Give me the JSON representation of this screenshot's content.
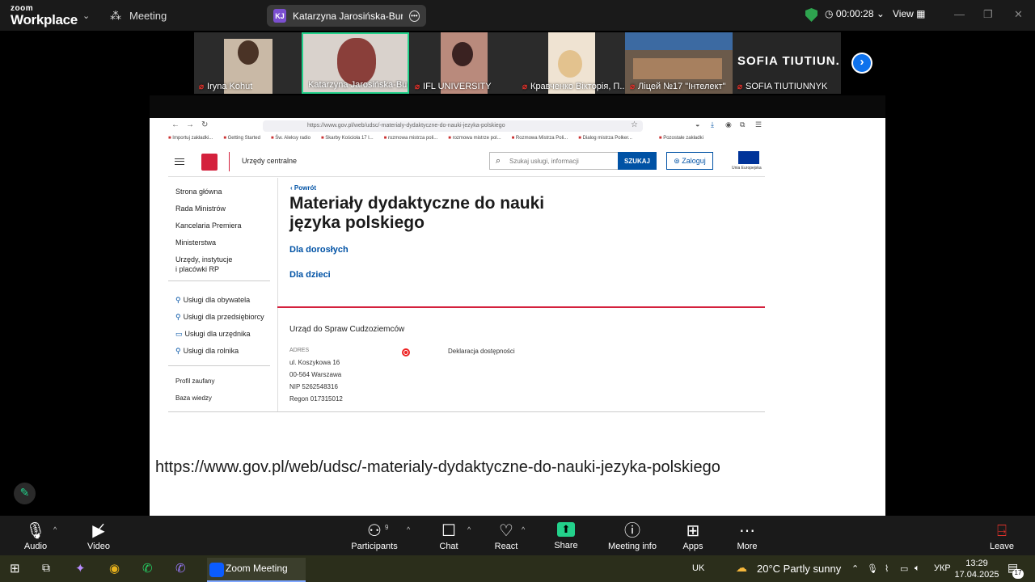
{
  "app": {
    "brand_top": "zoom",
    "brand_bottom": "Workplace",
    "tab": "Meeting"
  },
  "share_pill": {
    "initials": "KJ",
    "title": "Katarzyna Jarosińska-Buriak's scr"
  },
  "timer": "00:00:28",
  "view_label": "View",
  "participants_strip": [
    {
      "name": "Iryna Kohut",
      "muted": true
    },
    {
      "name": "Katarzyna Jarosińska-Buri...",
      "muted": false,
      "active": true
    },
    {
      "name": "IFL UNIVERSITY",
      "muted": true
    },
    {
      "name": "Кравченко Вікторія, П...",
      "muted": true
    },
    {
      "name": "Ліцей №17 \"Інтелект\"",
      "muted": true
    },
    {
      "name": "SOFIA TIUTIUNNYK",
      "muted": true,
      "big": "SOFIA  TIUTIUN..."
    }
  ],
  "browser": {
    "url": "https://www.gov.pl/web/udsc/-materialy-dydaktyczne-do-nauki-jezyka-polskiego",
    "bookmarks": [
      "Importuj zakładki...",
      "Getting Started",
      "Św. Aleksy radio",
      "Skarby Kościoła 17 l...",
      "rozmowa mistrza poli...",
      "rozmowa mistrze pol...",
      "Rozmowa Mistrza Poli...",
      "Dialog mistrza Polker...",
      "Pozostałe zakładki"
    ]
  },
  "site": {
    "section": "Urzędy centralne",
    "search_placeholder": "Szukaj usługi, informacji",
    "search_button": "SZUKAJ",
    "login_button": "Zaloguj",
    "eu_label": "Unia Europejska",
    "nav": [
      "Strona główna",
      "Rada Ministrów",
      "Kancelaria Premiera",
      "Ministerstwa",
      "Urzędy, instytucje",
      "i placówki RP"
    ],
    "nav_services": [
      "Usługi dla obywatela",
      "Usługi dla przedsiębiorcy",
      "Usługi dla urzędnika",
      "Usługi dla rolnika"
    ],
    "nav_extra": [
      "Profil zaufany",
      "Baza wiedzy"
    ],
    "back": "Powrót",
    "title_line1": "Materiały dydaktyczne do nauki",
    "title_line2": "języka polskiego",
    "link_adults": "Dla dorosłych",
    "link_kids": "Dla dzieci",
    "office": "Urząd do Spraw Cudzoziemców",
    "address_header": "ADRES",
    "address": [
      "ul. Koszykowa 16",
      "00-564 Warszawa",
      "NIP 5262548316",
      "Regon 017315012"
    ],
    "accessibility": "Deklaracja dostępności"
  },
  "big_url": "https://www.gov.pl/web/udsc/-materialy-dydaktyczne-do-nauki-jezyka-polskiego",
  "toolbar": {
    "audio": "Audio",
    "video": "Video",
    "participants": "Participants",
    "participants_count": "9",
    "chat": "Chat",
    "react": "React",
    "share": "Share",
    "meeting_info": "Meeting info",
    "apps": "Apps",
    "more": "More",
    "leave": "Leave"
  },
  "taskbar": {
    "zoom_app": "Zoom Meeting",
    "lang_uk": "UK",
    "weather": "20°C  Partly sunny",
    "lang_ukr": "УКР",
    "time": "13:29",
    "date": "17.04.2025",
    "notifications": "17"
  }
}
